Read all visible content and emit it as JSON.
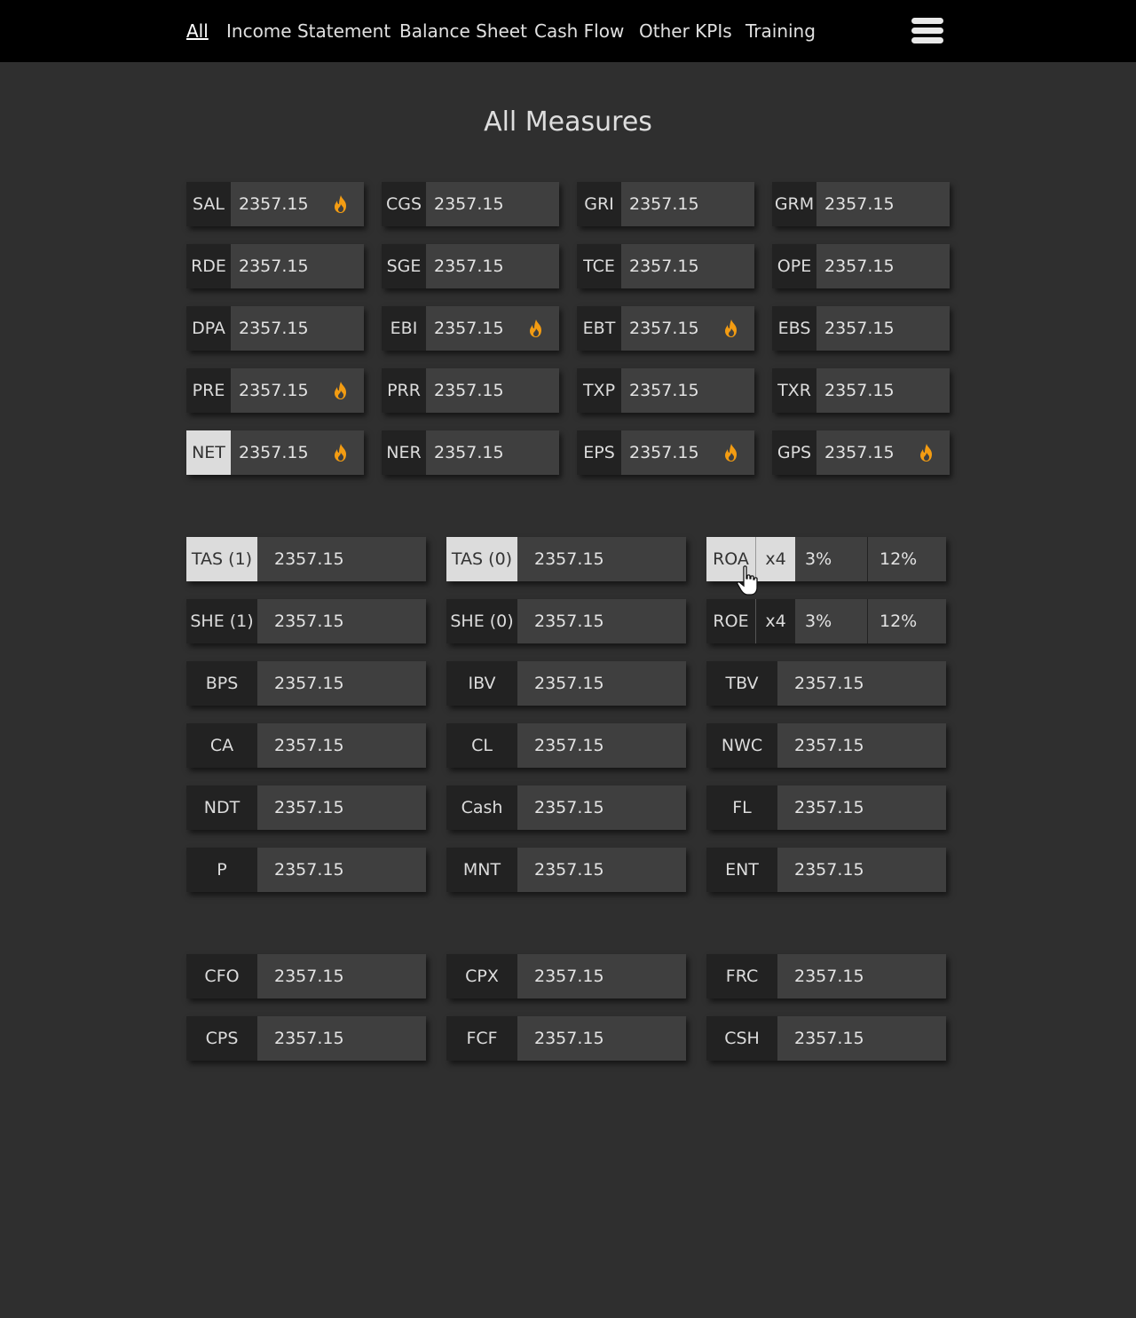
{
  "nav": {
    "links": [
      "All",
      "Income Statement",
      "Balance Sheet",
      "Cash Flow",
      "Other KPIs",
      "Training"
    ],
    "active": "All",
    "menu_icon": "hamburger-menu-icon"
  },
  "title": "All Measures",
  "accent_color": "#f39c12",
  "income_statement": [
    {
      "label": "SAL",
      "value": "2357.15",
      "hot": true
    },
    {
      "label": "CGS",
      "value": "2357.15",
      "hot": false
    },
    {
      "label": "GRI",
      "value": "2357.15",
      "hot": false
    },
    {
      "label": "GRM",
      "value": "2357.15",
      "hot": false
    },
    {
      "label": "RDE",
      "value": "2357.15",
      "hot": false
    },
    {
      "label": "SGE",
      "value": "2357.15",
      "hot": false
    },
    {
      "label": "TCE",
      "value": "2357.15",
      "hot": false
    },
    {
      "label": "OPE",
      "value": "2357.15",
      "hot": false
    },
    {
      "label": "DPA",
      "value": "2357.15",
      "hot": false
    },
    {
      "label": "EBI",
      "value": "2357.15",
      "hot": true
    },
    {
      "label": "EBT",
      "value": "2357.15",
      "hot": true
    },
    {
      "label": "EBS",
      "value": "2357.15",
      "hot": false
    },
    {
      "label": "PRE",
      "value": "2357.15",
      "hot": true
    },
    {
      "label": "PRR",
      "value": "2357.15",
      "hot": false
    },
    {
      "label": "TXP",
      "value": "2357.15",
      "hot": false
    },
    {
      "label": "TXR",
      "value": "2357.15",
      "hot": false
    },
    {
      "label": "NET",
      "value": "2357.15",
      "hot": true,
      "selected": true
    },
    {
      "label": "NER",
      "value": "2357.15",
      "hot": false
    },
    {
      "label": "EPS",
      "value": "2357.15",
      "hot": true
    },
    {
      "label": "GPS",
      "value": "2357.15",
      "hot": true
    }
  ],
  "balance_sheet": [
    {
      "label": "TAS (1)",
      "value": "2357.15",
      "selected": true
    },
    {
      "label": "TAS (0)",
      "value": "2357.15",
      "selected": true
    },
    {
      "label": "ROA",
      "multiplier": "x4",
      "pct1": "3%",
      "pct2": "12%",
      "selected": true
    },
    {
      "label": "SHE (1)",
      "value": "2357.15"
    },
    {
      "label": "SHE (0)",
      "value": "2357.15"
    },
    {
      "label": "ROE",
      "multiplier": "x4",
      "pct1": "3%",
      "pct2": "12%"
    },
    {
      "label": "BPS",
      "value": "2357.15"
    },
    {
      "label": "IBV",
      "value": "2357.15"
    },
    {
      "label": "TBV",
      "value": "2357.15"
    },
    {
      "label": "CA",
      "value": "2357.15"
    },
    {
      "label": "CL",
      "value": "2357.15"
    },
    {
      "label": "NWC",
      "value": "2357.15"
    },
    {
      "label": "NDT",
      "value": "2357.15"
    },
    {
      "label": "Cash",
      "value": "2357.15"
    },
    {
      "label": "FL",
      "value": "2357.15"
    },
    {
      "label": "P",
      "value": "2357.15"
    },
    {
      "label": "MNT",
      "value": "2357.15"
    },
    {
      "label": "ENT",
      "value": "2357.15"
    }
  ],
  "cash_flow": [
    {
      "label": "CFO",
      "value": "2357.15"
    },
    {
      "label": "CPX",
      "value": "2357.15"
    },
    {
      "label": "FRC",
      "value": "2357.15"
    },
    {
      "label": "CPS",
      "value": "2357.15"
    },
    {
      "label": "FCF",
      "value": "2357.15"
    },
    {
      "label": "CSH",
      "value": "2357.15"
    }
  ]
}
